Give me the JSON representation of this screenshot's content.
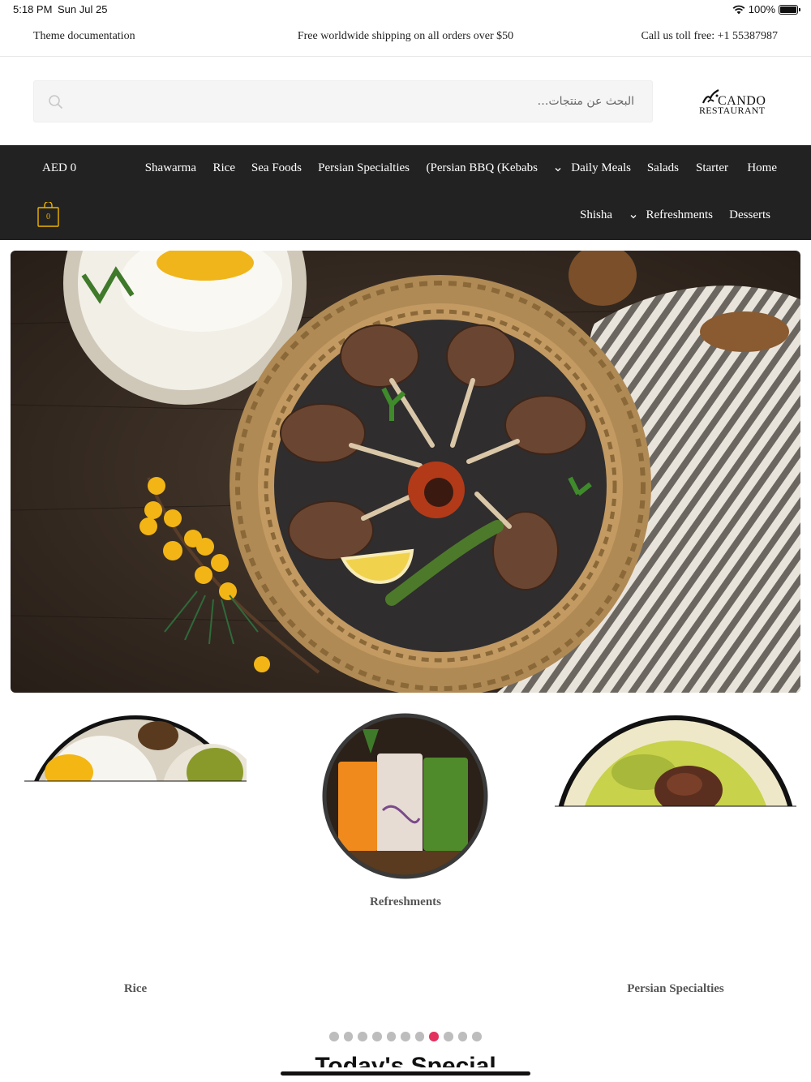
{
  "status_bar": {
    "time": "5:18 PM",
    "date": "Sun Jul 25",
    "battery": "100%",
    "battery_level": 1.0
  },
  "top_bar": {
    "left_link": "Theme documentation",
    "center_text": "Free worldwide shipping on all orders over $50",
    "right_text": "Call us toll free: +1 55387987"
  },
  "header": {
    "search_placeholder": "البحث عن منتجات…",
    "logo": {
      "brand": "CANDO",
      "sub": "RESTAURANT"
    }
  },
  "nav": {
    "price": "AED 0",
    "cart_count": "0",
    "row1": [
      "Home",
      "Starter",
      "Salads",
      "Daily Meals",
      "(Persian BBQ (Kebabs",
      "Persian Specialties",
      "Sea Foods",
      "Rice",
      "Shawarma"
    ],
    "row2": [
      "Desserts",
      "Refreshments",
      "Shisha"
    ]
  },
  "categories": {
    "items": [
      {
        "label": "Rice"
      },
      {
        "label": "Refreshments"
      },
      {
        "label": "Persian Specialties"
      }
    ],
    "slide_count": 11,
    "active_slide": 8
  },
  "section": {
    "title": "Today's Special"
  },
  "colors": {
    "nav_bg": "#222222",
    "accent_dot": "#e2325d",
    "cart_accent": "#f0b400"
  }
}
